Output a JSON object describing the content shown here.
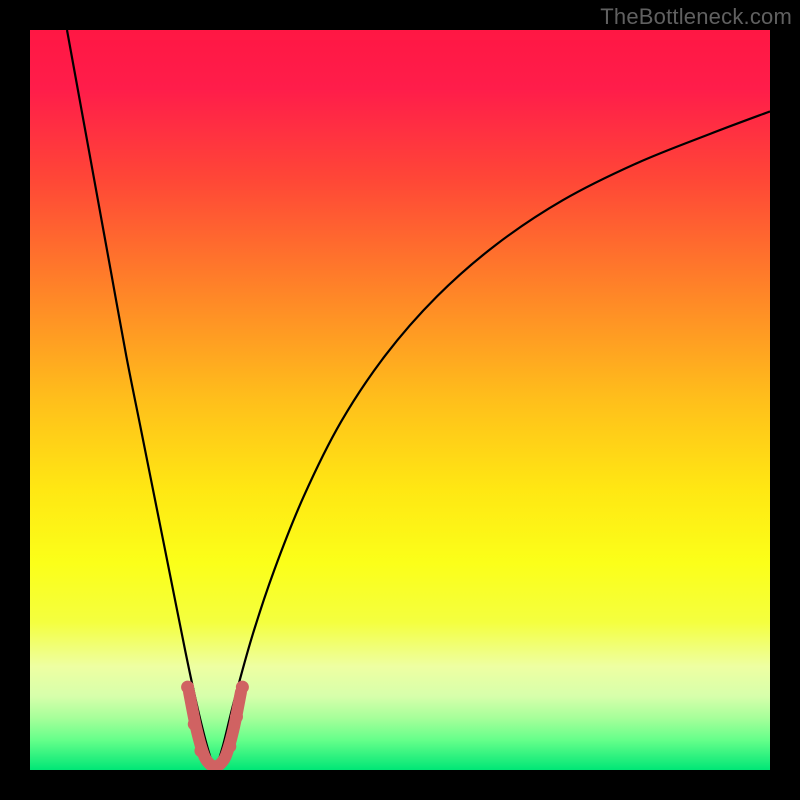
{
  "watermark": "TheBottleneck.com",
  "chart_data": {
    "type": "line",
    "title": "",
    "xlabel": "",
    "ylabel": "",
    "xlim": [
      0,
      100
    ],
    "ylim": [
      0,
      100
    ],
    "gradient_stops": [
      {
        "offset": 0.0,
        "color": "#ff1744"
      },
      {
        "offset": 0.08,
        "color": "#ff1d4a"
      },
      {
        "offset": 0.2,
        "color": "#ff4637"
      },
      {
        "offset": 0.35,
        "color": "#ff8328"
      },
      {
        "offset": 0.5,
        "color": "#ffbf1b"
      },
      {
        "offset": 0.62,
        "color": "#ffe713"
      },
      {
        "offset": 0.72,
        "color": "#fbff19"
      },
      {
        "offset": 0.8,
        "color": "#f4ff3f"
      },
      {
        "offset": 0.86,
        "color": "#eeffa2"
      },
      {
        "offset": 0.9,
        "color": "#d7ffab"
      },
      {
        "offset": 0.93,
        "color": "#a6ff9a"
      },
      {
        "offset": 0.96,
        "color": "#64ff8a"
      },
      {
        "offset": 1.0,
        "color": "#00e676"
      }
    ],
    "series": [
      {
        "name": "bottleneck-curve",
        "stroke": "#000000",
        "stroke_width": 2.2,
        "x": [
          5,
          7,
          9,
          11,
          13,
          15,
          17,
          19,
          21,
          22.5,
          24,
          25,
          26,
          27.5,
          30,
          33,
          37,
          42,
          48,
          55,
          63,
          72,
          82,
          92,
          100
        ],
        "y": [
          100,
          89,
          78,
          67,
          56,
          46,
          36,
          26,
          16,
          9,
          3,
          0.5,
          3,
          9,
          18,
          27,
          37,
          47,
          56,
          64,
          71,
          77,
          82,
          86,
          89
        ]
      },
      {
        "name": "highlight-bottom",
        "stroke": "#d06262",
        "stroke_width": 12,
        "linecap": "round",
        "x": [
          21.5,
          22.5,
          23.5,
          24.3,
          25.0,
          25.7,
          26.5,
          27.5,
          28.5
        ],
        "y": [
          10.5,
          5.5,
          2.0,
          0.8,
          0.5,
          0.8,
          2.0,
          5.5,
          10.5
        ]
      }
    ],
    "highlight_dots": {
      "stroke": "#d06262",
      "radius": 6.5,
      "points": [
        {
          "x": 21.3,
          "y": 11.2
        },
        {
          "x": 22.2,
          "y": 6.2
        },
        {
          "x": 23.1,
          "y": 2.6
        },
        {
          "x": 27.0,
          "y": 3.2
        },
        {
          "x": 27.9,
          "y": 7.2
        },
        {
          "x": 28.7,
          "y": 11.2
        }
      ]
    }
  }
}
